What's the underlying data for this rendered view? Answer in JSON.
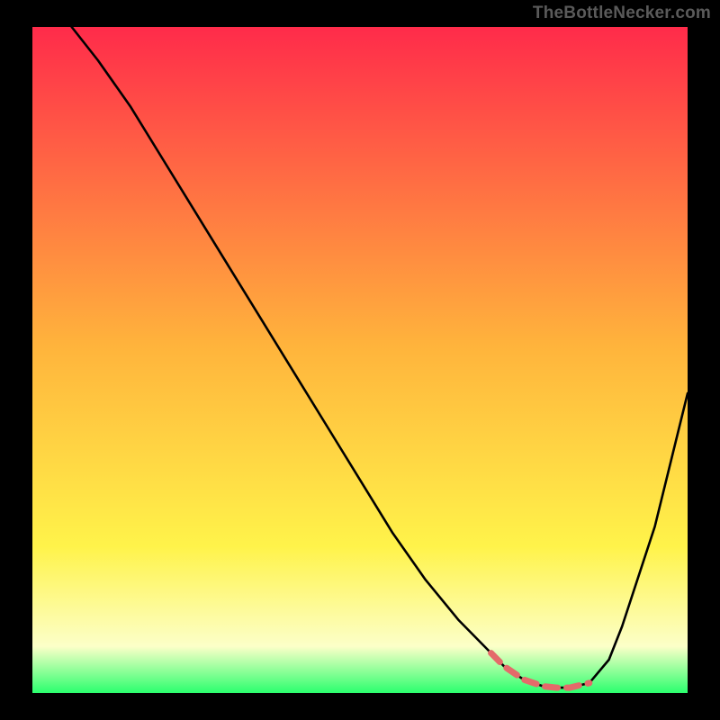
{
  "watermark": {
    "text": "TheBottleNecker.com"
  },
  "colors": {
    "background": "#000000",
    "border": "#000000",
    "grad_top": "#ff2b4a",
    "grad_mid": "#ffb43c",
    "grad_low": "#fff34a",
    "grad_pale": "#fcffc8",
    "grad_bottom": "#2bff6e",
    "curve": "#000000",
    "highlight": "#e46a6a"
  },
  "chart_data": {
    "type": "line",
    "title": "",
    "xlabel": "",
    "ylabel": "",
    "xlim": [
      0,
      100
    ],
    "ylim": [
      0,
      100
    ],
    "legend": false,
    "grid": false,
    "series": [
      {
        "name": "bottleneck-curve",
        "x": [
          6,
          10,
          15,
          20,
          25,
          30,
          35,
          40,
          45,
          50,
          55,
          60,
          65,
          70,
          72,
          75,
          78,
          80,
          82,
          85,
          88,
          90,
          95,
          100
        ],
        "y": [
          100,
          95,
          88,
          80,
          72,
          64,
          56,
          48,
          40,
          32,
          24,
          17,
          11,
          6,
          4,
          2,
          1,
          0.8,
          0.8,
          1.5,
          5,
          10,
          25,
          45
        ]
      }
    ],
    "highlight_range_x": [
      70,
      86
    ],
    "annotations": []
  }
}
